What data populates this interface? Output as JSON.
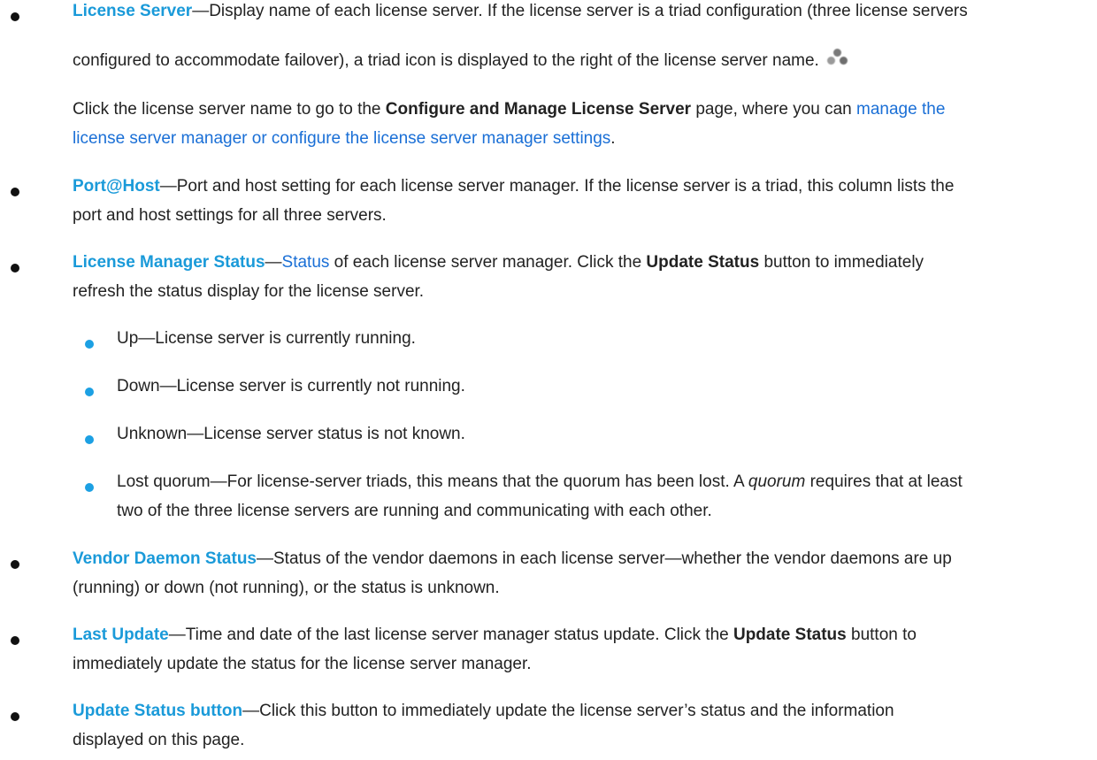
{
  "items": {
    "license_server": {
      "term": "License Server",
      "desc": "—Display name of each license server. If the license server is a triad configuration (three license servers",
      "line2": "configured to accommodate failover), a triad icon is displayed to the right of the license server name.",
      "triad_icon": "triad-icon",
      "para2_pre": "Click the license server name to go to the ",
      "para2_bold": "Configure and Manage License Server",
      "para2_mid": " page, where you can ",
      "para2_link1": "manage the",
      "para2_link2": "license server manager or configure the license server manager settings",
      "para2_end": "."
    },
    "port_host": {
      "term": "Port@Host",
      "desc": "—Port and host setting for each license server manager. If the license server is a triad, this column lists the",
      "line2": "port and host settings for all three servers."
    },
    "license_manager_status": {
      "term": "License Manager Status",
      "dash": "—",
      "link": "Status",
      "desc_pre": " of each license server manager. Click the ",
      "bold": "Update Status",
      "desc_post": " button to immediately",
      "line2": "refresh the status display for the license server.",
      "sub_items": [
        {
          "text": "Up—License server is currently running."
        },
        {
          "text": "Down—License server is currently not running."
        },
        {
          "text": "Unknown—License server status is not known."
        }
      ],
      "lost_quorum": {
        "pre": "Lost quorum—For license-server triads, this means that the quorum has been lost. A ",
        "em": "quorum",
        "post": " requires that at least",
        "line2": "two of the three license servers are running and communicating with each other."
      }
    },
    "vendor_daemon_status": {
      "term": "Vendor Daemon Status",
      "desc": "—Status of the vendor daemons in each license server—whether the vendor daemons are up",
      "line2": "(running) or down (not running), or the status is unknown."
    },
    "last_update": {
      "term": "Last Update",
      "desc_pre": "—Time and date of the last license server manager status update. Click the ",
      "bold": "Update Status",
      "desc_post": " button to",
      "line2": "immediately update the status for the license server manager."
    },
    "update_status_button": {
      "term": "Update Status button",
      "desc": "—Click this button to immediately update the license server’s status and the information",
      "line2": "displayed on this page."
    }
  },
  "colors": {
    "term": "#1a9ad9",
    "link": "#1a6fd6",
    "sub_bullet": "#1ca0e3",
    "text": "#222222"
  }
}
